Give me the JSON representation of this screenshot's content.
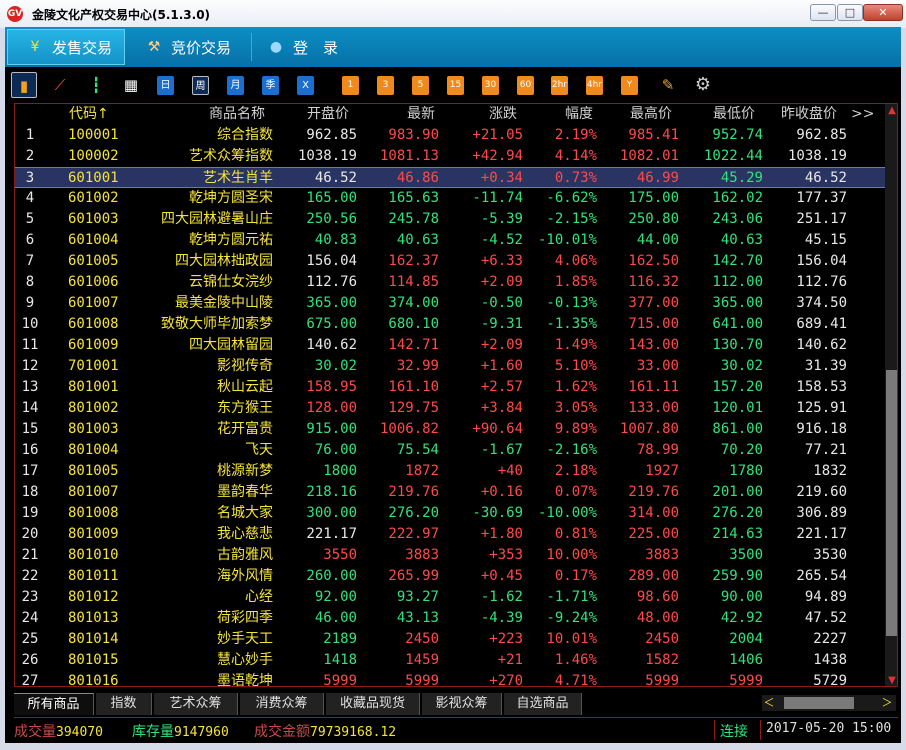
{
  "window": {
    "title": "金陵文化产权交易中心(5.1.3.0)",
    "logo": "GV",
    "min": "—",
    "max": "□",
    "close": "✕"
  },
  "nav": {
    "tabs": [
      {
        "label": "发售交易",
        "icon": "¥"
      },
      {
        "label": "竞价交易",
        "icon": "⚒"
      },
      {
        "label": "登　录",
        "icon": "●"
      }
    ]
  },
  "toolbar": {
    "icons": [
      "bar-chart-icon",
      "line-chart-icon",
      "candlestick-icon",
      "calendar-icon"
    ],
    "periods": [
      "日",
      "周",
      "月",
      "季",
      "X"
    ],
    "minutes": [
      "1",
      "3",
      "5",
      "15",
      "30",
      "60",
      "2hr",
      "4hr",
      "Y"
    ],
    "draw": "✎",
    "gear": "⚙"
  },
  "columns": [
    "代码↑",
    "商品名称",
    "开盘价",
    "最新",
    "涨跌",
    "幅度",
    "最高价",
    "最低价",
    "昨收盘价",
    ">>"
  ],
  "rows": [
    {
      "n": "1",
      "code": "100001",
      "name": "综合指数",
      "open": "962.85",
      "last": "983.90",
      "chg": "+21.05",
      "pct": "2.19%",
      "high": "985.41",
      "low": "952.74",
      "prev": "962.85"
    },
    {
      "n": "2",
      "code": "100002",
      "name": "艺术众筹指数",
      "open": "1038.19",
      "last": "1081.13",
      "chg": "+42.94",
      "pct": "4.14%",
      "high": "1082.01",
      "low": "1022.44",
      "prev": "1038.19"
    },
    {
      "n": "3",
      "code": "601001",
      "name": "艺术生肖羊",
      "open": "46.52",
      "last": "46.86",
      "chg": "+0.34",
      "pct": "0.73%",
      "high": "46.99",
      "low": "45.29",
      "prev": "46.52"
    },
    {
      "n": "4",
      "code": "601002",
      "name": "乾坤方圆圣宋",
      "open": "165.00",
      "last": "165.63",
      "chg": "-11.74",
      "pct": "-6.62%",
      "high": "175.00",
      "low": "162.02",
      "prev": "177.37"
    },
    {
      "n": "5",
      "code": "601003",
      "name": "四大园林避暑山庄",
      "open": "250.56",
      "last": "245.78",
      "chg": "-5.39",
      "pct": "-2.15%",
      "high": "250.80",
      "low": "243.06",
      "prev": "251.17"
    },
    {
      "n": "6",
      "code": "601004",
      "name": "乾坤方圆元祐",
      "open": "40.83",
      "last": "40.63",
      "chg": "-4.52",
      "pct": "-10.01%",
      "high": "44.00",
      "low": "40.63",
      "prev": "45.15"
    },
    {
      "n": "7",
      "code": "601005",
      "name": "四大园林拙政园",
      "open": "156.04",
      "last": "162.37",
      "chg": "+6.33",
      "pct": "4.06%",
      "high": "162.50",
      "low": "142.70",
      "prev": "156.04"
    },
    {
      "n": "8",
      "code": "601006",
      "name": "云锦仕女浣纱",
      "open": "112.76",
      "last": "114.85",
      "chg": "+2.09",
      "pct": "1.85%",
      "high": "116.32",
      "low": "112.00",
      "prev": "112.76"
    },
    {
      "n": "9",
      "code": "601007",
      "name": "最美金陵中山陵",
      "open": "365.00",
      "last": "374.00",
      "chg": "-0.50",
      "pct": "-0.13%",
      "high": "377.00",
      "low": "365.00",
      "prev": "374.50"
    },
    {
      "n": "10",
      "code": "601008",
      "name": "致敬大师毕加索梦",
      "open": "675.00",
      "last": "680.10",
      "chg": "-9.31",
      "pct": "-1.35%",
      "high": "715.00",
      "low": "641.00",
      "prev": "689.41"
    },
    {
      "n": "11",
      "code": "601009",
      "name": "四大园林留园",
      "open": "140.62",
      "last": "142.71",
      "chg": "+2.09",
      "pct": "1.49%",
      "high": "143.00",
      "low": "130.70",
      "prev": "140.62"
    },
    {
      "n": "12",
      "code": "701001",
      "name": "影视传奇",
      "open": "30.02",
      "last": "32.99",
      "chg": "+1.60",
      "pct": "5.10%",
      "high": "33.00",
      "low": "30.02",
      "prev": "31.39"
    },
    {
      "n": "13",
      "code": "801001",
      "name": "秋山云起",
      "open": "158.95",
      "last": "161.10",
      "chg": "+2.57",
      "pct": "1.62%",
      "high": "161.11",
      "low": "157.20",
      "prev": "158.53"
    },
    {
      "n": "14",
      "code": "801002",
      "name": "东方猴王",
      "open": "128.00",
      "last": "129.75",
      "chg": "+3.84",
      "pct": "3.05%",
      "high": "133.00",
      "low": "120.01",
      "prev": "125.91"
    },
    {
      "n": "15",
      "code": "801003",
      "name": "花开富贵",
      "open": "915.00",
      "last": "1006.82",
      "chg": "+90.64",
      "pct": "9.89%",
      "high": "1007.80",
      "low": "861.00",
      "prev": "916.18"
    },
    {
      "n": "16",
      "code": "801004",
      "name": "飞天",
      "open": "76.00",
      "last": "75.54",
      "chg": "-1.67",
      "pct": "-2.16%",
      "high": "78.99",
      "low": "70.20",
      "prev": "77.21"
    },
    {
      "n": "17",
      "code": "801005",
      "name": "桃源新梦",
      "open": "1800",
      "last": "1872",
      "chg": "+40",
      "pct": "2.18%",
      "high": "1927",
      "low": "1780",
      "prev": "1832"
    },
    {
      "n": "18",
      "code": "801007",
      "name": "墨韵春华",
      "open": "218.16",
      "last": "219.76",
      "chg": "+0.16",
      "pct": "0.07%",
      "high": "219.76",
      "low": "201.00",
      "prev": "219.60"
    },
    {
      "n": "19",
      "code": "801008",
      "name": "名城大家",
      "open": "300.00",
      "last": "276.20",
      "chg": "-30.69",
      "pct": "-10.00%",
      "high": "314.00",
      "low": "276.20",
      "prev": "306.89"
    },
    {
      "n": "20",
      "code": "801009",
      "name": "我心慈悲",
      "open": "221.17",
      "last": "222.97",
      "chg": "+1.80",
      "pct": "0.81%",
      "high": "225.00",
      "low": "214.63",
      "prev": "221.17"
    },
    {
      "n": "21",
      "code": "801010",
      "name": "古韵雅风",
      "open": "3550",
      "last": "3883",
      "chg": "+353",
      "pct": "10.00%",
      "high": "3883",
      "low": "3500",
      "prev": "3530"
    },
    {
      "n": "22",
      "code": "801011",
      "name": "海外风情",
      "open": "260.00",
      "last": "265.99",
      "chg": "+0.45",
      "pct": "0.17%",
      "high": "289.00",
      "low": "259.90",
      "prev": "265.54"
    },
    {
      "n": "23",
      "code": "801012",
      "name": "心经",
      "open": "92.00",
      "last": "93.27",
      "chg": "-1.62",
      "pct": "-1.71%",
      "high": "98.60",
      "low": "90.00",
      "prev": "94.89"
    },
    {
      "n": "24",
      "code": "801013",
      "name": "荷彩四季",
      "open": "46.00",
      "last": "43.13",
      "chg": "-4.39",
      "pct": "-9.24%",
      "high": "48.00",
      "low": "42.92",
      "prev": "47.52"
    },
    {
      "n": "25",
      "code": "801014",
      "name": "妙手天工",
      "open": "2189",
      "last": "2450",
      "chg": "+223",
      "pct": "10.01%",
      "high": "2450",
      "low": "2004",
      "prev": "2227"
    },
    {
      "n": "26",
      "code": "801015",
      "name": "慧心妙手",
      "open": "1418",
      "last": "1459",
      "chg": "+21",
      "pct": "1.46%",
      "high": "1582",
      "low": "1406",
      "prev": "1438"
    },
    {
      "n": "27",
      "code": "801016",
      "name": "墨语乾坤",
      "open": "5999",
      "last": "5999",
      "chg": "+270",
      "pct": "4.71%",
      "high": "5999",
      "low": "5999",
      "prev": "5729"
    }
  ],
  "bottom_tabs": [
    "所有商品",
    "指数",
    "艺术众筹",
    "消费众筹",
    "收藏品现货",
    "影视众筹",
    "自选商品"
  ],
  "status": {
    "volume_label": "成交量",
    "volume": "394070",
    "stock_label": "库存量",
    "stock": "9147960",
    "amount_label": "成交金额",
    "amount": "79739168.12",
    "conn": "连接",
    "datetime": "2017-05-20 15:00"
  },
  "colors": {
    "up": "#ff4a4a",
    "down": "#33e27a",
    "flat": "#e8e8e8",
    "name": "#f4e33a",
    "border": "#8b1a1a"
  }
}
